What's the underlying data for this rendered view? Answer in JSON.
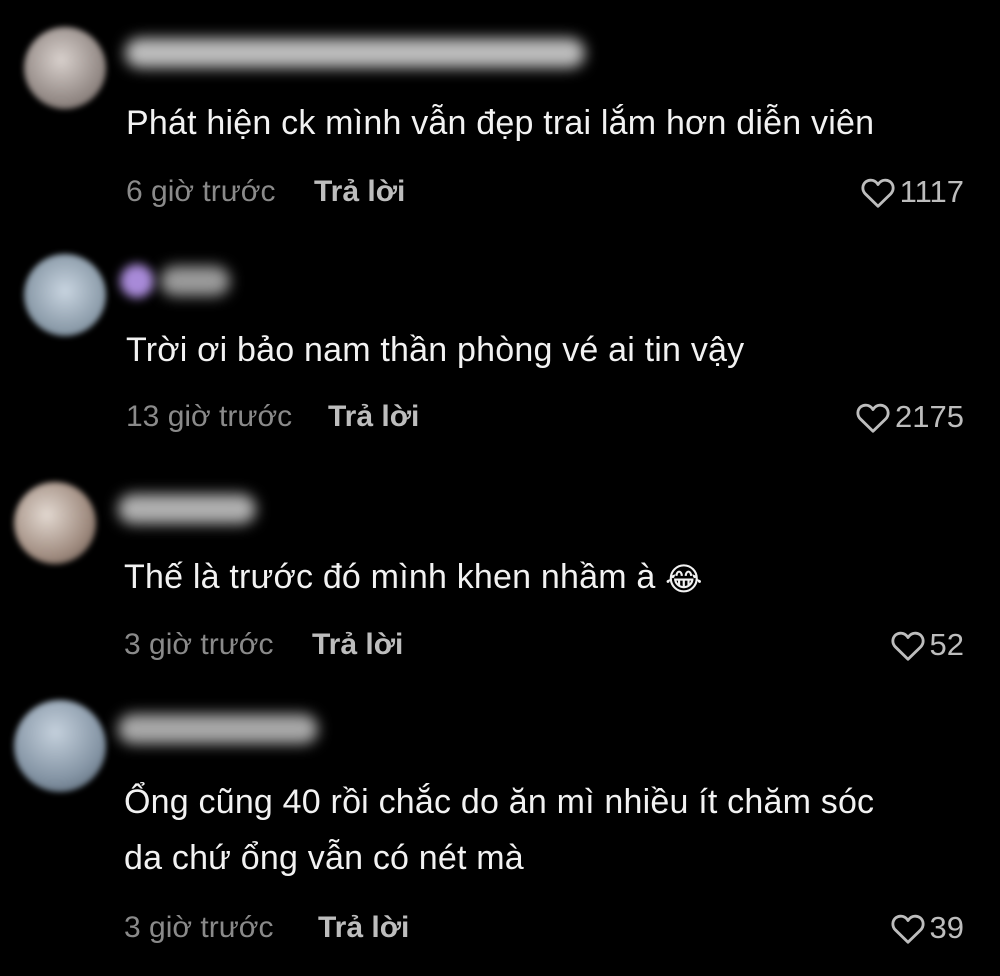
{
  "comments": [
    {
      "text": "Phát hiện ck mình vẫn đẹp trai lắm hơn diễn viên",
      "time": "6 giờ trước",
      "reply_label": "Trả lời",
      "likes": "1117"
    },
    {
      "text": "Trời ơi bảo nam thần phòng vé ai tin vậy",
      "time": "13 giờ trước",
      "reply_label": "Trả lời",
      "likes": "2175"
    },
    {
      "text": "Thế là trước đó mình khen nhầm à",
      "emoji": "😂",
      "time": "3 giờ trước",
      "reply_label": "Trả lời",
      "likes": "52"
    },
    {
      "text_line1": "Ổng cũng 40 rồi chắc do ăn mì nhiều ít chăm sóc",
      "text_line2": "da chứ ổng vẫn có nét mà",
      "time": "3 giờ trước",
      "reply_label": "Trả lời",
      "likes": "39"
    }
  ],
  "icons": {
    "like": "heart-outline-icon"
  },
  "colors": {
    "background": "#000000",
    "text": "#f2f2f2",
    "meta": "#8a8a8a"
  }
}
